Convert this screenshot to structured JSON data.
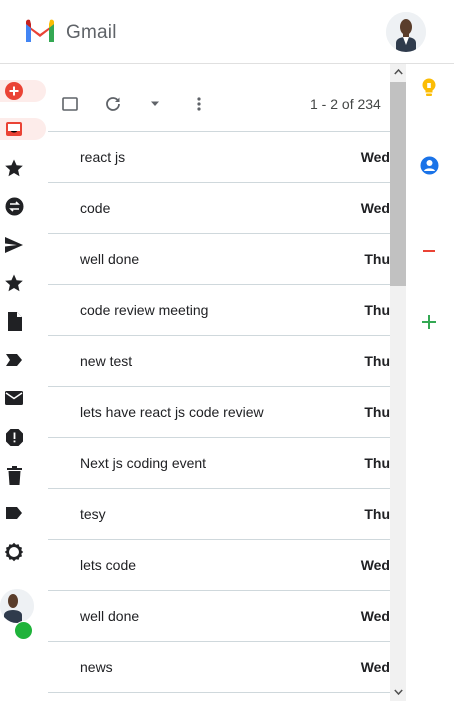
{
  "header": {
    "app_name": "Gmail",
    "logo_icon": "gmail-logo-icon",
    "avatar_icon": "user-avatar"
  },
  "rail": {
    "items": [
      {
        "icon": "compose-plus-icon",
        "color": "#ea4335"
      },
      {
        "icon": "inbox-icon",
        "color": "#ea4335"
      },
      {
        "icon": "star-icon",
        "color": "#202124"
      },
      {
        "icon": "swap-icon",
        "color": "#202124"
      },
      {
        "icon": "send-icon",
        "color": "#202124"
      },
      {
        "icon": "star-icon",
        "color": "#202124"
      },
      {
        "icon": "draft-document-icon",
        "color": "#202124"
      },
      {
        "icon": "label-arrow-icon",
        "color": "#202124"
      },
      {
        "icon": "mail-icon",
        "color": "#202124"
      },
      {
        "icon": "spam-alert-icon",
        "color": "#202124"
      },
      {
        "icon": "trash-icon",
        "color": "#202124"
      },
      {
        "icon": "label-icon",
        "color": "#202124"
      },
      {
        "icon": "settings-gear-icon",
        "color": "#202124"
      }
    ],
    "status_color": "#1fb33a"
  },
  "toolbar": {
    "pagination": "1 - 2 of 234"
  },
  "emails": [
    {
      "subject": "react js",
      "date": "Wed"
    },
    {
      "subject": "code",
      "date": "Wed"
    },
    {
      "subject": "well done",
      "date": "Thu"
    },
    {
      "subject": "code review meeting",
      "date": "Thu"
    },
    {
      "subject": "new test",
      "date": "Thu"
    },
    {
      "subject": "lets have react js code review",
      "date": "Thu"
    },
    {
      "subject": "Next js coding event",
      "date": "Thu"
    },
    {
      "subject": "tesy",
      "date": "Thu"
    },
    {
      "subject": "lets code",
      "date": "Wed"
    },
    {
      "subject": "well done",
      "date": "Wed"
    },
    {
      "subject": "news",
      "date": "Wed"
    }
  ],
  "side_panel": {
    "icons": [
      {
        "icon": "keep-bulb-icon",
        "color": "#fbbc04"
      },
      {
        "icon": "contacts-icon",
        "color": "#1a73e8"
      },
      {
        "icon": "minus-icon",
        "color": "#ea4335"
      },
      {
        "icon": "add-icon",
        "color": "#34a853"
      }
    ]
  }
}
